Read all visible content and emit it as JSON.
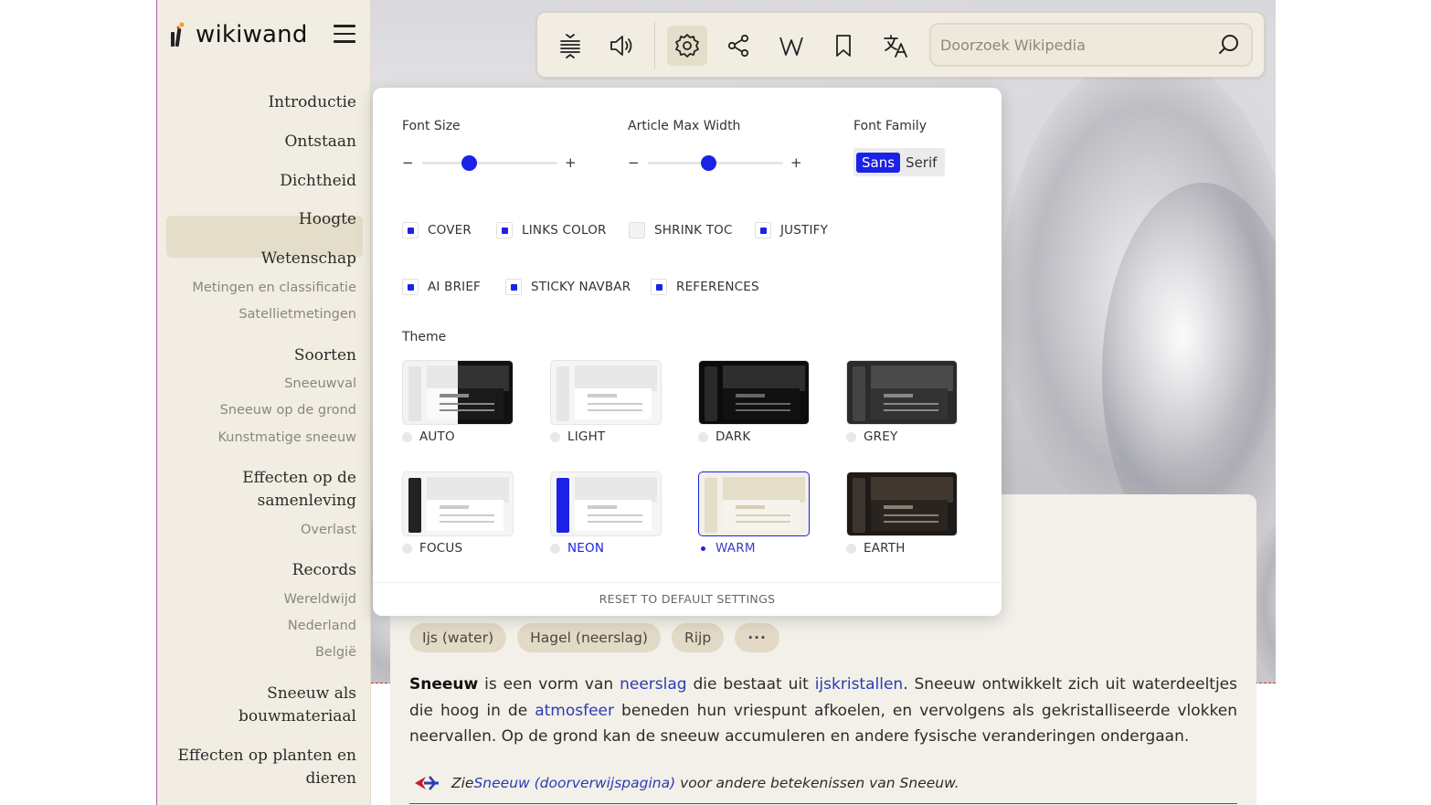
{
  "brand": {
    "name": "wikiwand"
  },
  "toc": {
    "sections": [
      {
        "label": "Introductie"
      },
      {
        "label": "Ontstaan"
      },
      {
        "label": "Dichtheid"
      },
      {
        "label": "Hoogte"
      },
      {
        "label": "Wetenschap"
      },
      {
        "label": "Metingen en classificatie"
      },
      {
        "label": "Satellietmetingen"
      },
      {
        "label": "Soorten"
      },
      {
        "label": "Sneeuwval"
      },
      {
        "label": "Sneeuw op de grond"
      },
      {
        "label": "Kunstmatige sneeuw"
      },
      {
        "label": "Effecten op de"
      },
      {
        "label": "samenleving"
      },
      {
        "label": "Overlast"
      },
      {
        "label": "Records"
      },
      {
        "label": "Wereldwijd"
      },
      {
        "label": "Nederland"
      },
      {
        "label": "België"
      },
      {
        "label": "Sneeuw als"
      },
      {
        "label": "bouwmateriaal"
      },
      {
        "label": "Effecten op planten en"
      },
      {
        "label": "dieren"
      }
    ],
    "active": "Hoogte"
  },
  "toolbar": {
    "buttons": [
      "toc-toggle-icon",
      "speaker-icon",
      "gear-icon",
      "share-icon",
      "wikipedia-icon",
      "bookmark-icon",
      "translate-icon"
    ],
    "search_placeholder": "Doorzoek Wikipedia"
  },
  "settings": {
    "font_size": {
      "label": "Font Size",
      "minus": "−",
      "plus": "+",
      "value": 0.35
    },
    "max_width": {
      "label": "Article Max Width",
      "minus": "−",
      "plus": "+",
      "value": 0.45
    },
    "font_family": {
      "label": "Font Family",
      "options": [
        "Sans",
        "Serif"
      ],
      "selected": "Sans"
    },
    "toggles": [
      {
        "label": "COVER",
        "checked": true
      },
      {
        "label": "LINKS COLOR",
        "checked": true
      },
      {
        "label": "SHRINK TOC",
        "checked": false
      },
      {
        "label": "JUSTIFY",
        "checked": true
      },
      {
        "label": "AI BRIEF",
        "checked": true
      },
      {
        "label": "STICKY NAVBAR",
        "checked": true
      },
      {
        "label": "REFERENCES",
        "checked": true
      }
    ],
    "theme": {
      "label": "Theme",
      "options": [
        "AUTO",
        "LIGHT",
        "DARK",
        "GREY",
        "FOCUS",
        "NEON",
        "WARM",
        "EARTH"
      ],
      "selected": "WARM"
    },
    "reset": "RESET TO DEFAULT SETTINGS"
  },
  "article": {
    "chips": [
      "Ijs (water)",
      "Hagel (neerslag)",
      "Rijp",
      "···"
    ],
    "p1": {
      "bold": "Sneeuw",
      "t1": " is een vorm van ",
      "l1": "neerslag",
      "t2": " die bestaat uit ",
      "l2": "ijskristallen",
      "t3": ". Sneeuw ontwikkelt zich uit waterdeeltjes die hoog in de ",
      "l3": "atmosfeer",
      "t4": " beneden hun vriespunt afkoelen, en vervolgens als gekristalliseerde vlokken neervallen. Op de grond kan de sneeuw accumuleren en andere fysische veranderingen ondergaan."
    },
    "hatnote": {
      "pre": "Zie ",
      "link": "Sneeuw (doorverwijspagina)",
      "post": " voor andere betekenissen van Sneeuw."
    }
  },
  "colors": {
    "accent": "#1a22e8",
    "sidebar_bg": "#f1ede2",
    "link": "#2b3bb5"
  }
}
